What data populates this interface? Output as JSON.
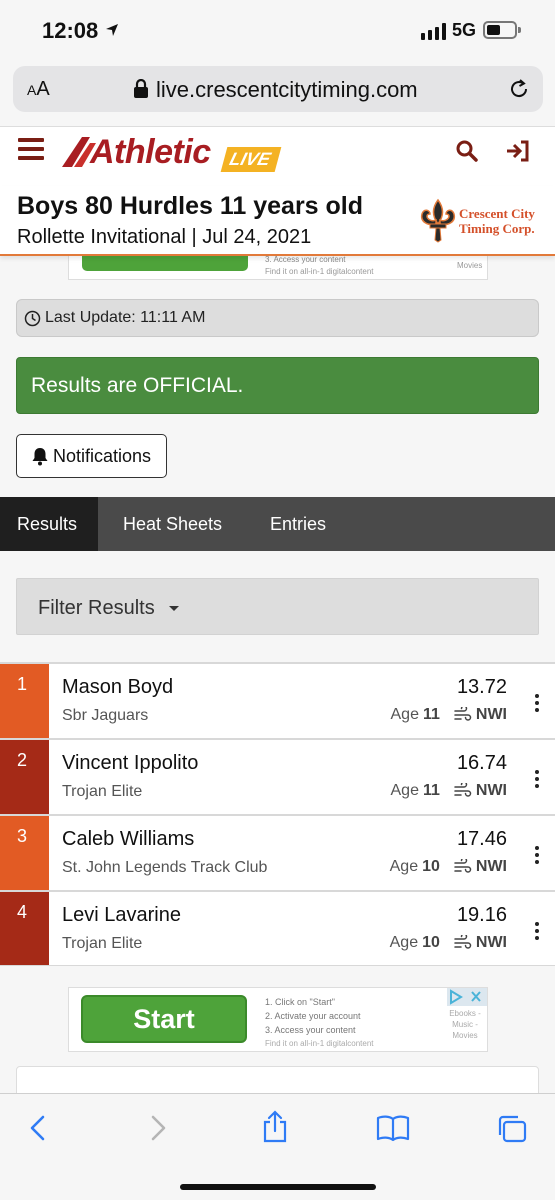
{
  "status_bar": {
    "time": "12:08",
    "network": "5G"
  },
  "browser": {
    "text_size": "AA",
    "url": "live.crescentcitytiming.com"
  },
  "site": {
    "logo_main": "Athletic",
    "logo_badge": "LIVE"
  },
  "event": {
    "title": "Boys 80 Hurdles 11 years old",
    "subtitle": "Rollette Invitational | Jul 24, 2021",
    "sponsor_line1": "Crescent City",
    "sponsor_line2": "Timing Corp."
  },
  "ad_top": {
    "line1": "3. Access your content",
    "line2": "Find it on all-in-1 digitalcontent",
    "line3": "Movies"
  },
  "last_update": "Last Update: 11:11 AM",
  "official_banner": "Results are OFFICIAL.",
  "notifications_label": "Notifications",
  "tabs": [
    {
      "label": "Results",
      "active": true
    },
    {
      "label": "Heat Sheets",
      "active": false
    },
    {
      "label": "Entries",
      "active": false
    }
  ],
  "filter_label": "Filter Results",
  "results": [
    {
      "place": "1",
      "name": "Mason Boyd",
      "team": "Sbr Jaguars",
      "time": "13.72",
      "age_label": "Age",
      "age": "11",
      "wind": "NWI",
      "color": "#e25b24"
    },
    {
      "place": "2",
      "name": "Vincent Ippolito",
      "team": "Trojan Elite",
      "time": "16.74",
      "age_label": "Age",
      "age": "11",
      "wind": "NWI",
      "color": "#a52a17"
    },
    {
      "place": "3",
      "name": "Caleb Williams",
      "team": "St. John Legends Track Club",
      "time": "17.46",
      "age_label": "Age",
      "age": "10",
      "wind": "NWI",
      "color": "#e25b24"
    },
    {
      "place": "4",
      "name": "Levi Lavarine",
      "team": "Trojan Elite",
      "time": "19.16",
      "age_label": "Age",
      "age": "10",
      "wind": "NWI",
      "color": "#a52a17"
    }
  ],
  "ad_bottom": {
    "button": "Start",
    "step1": "1. Click on \"Start\"",
    "step2": "2. Activate your account",
    "step3": "3. Access your content",
    "footer": "Find it on all-in-1 digitalcontent",
    "cat1": "Ebooks -",
    "cat2": "Music -",
    "cat3": "Movies"
  },
  "colors": {
    "brand_red": "#a81d22",
    "brand_gold": "#f4b223",
    "official_green": "#4a8c3f",
    "ios_blue": "#2f7bf5"
  },
  "icons": [
    "location-arrow-icon",
    "lock-icon",
    "reload-icon",
    "menu-icon",
    "search-icon",
    "login-icon",
    "clock-icon",
    "bell-icon",
    "wind-icon",
    "more-vertical-icon",
    "back-icon",
    "forward-icon",
    "share-icon",
    "bookmarks-icon",
    "tabs-icon"
  ]
}
